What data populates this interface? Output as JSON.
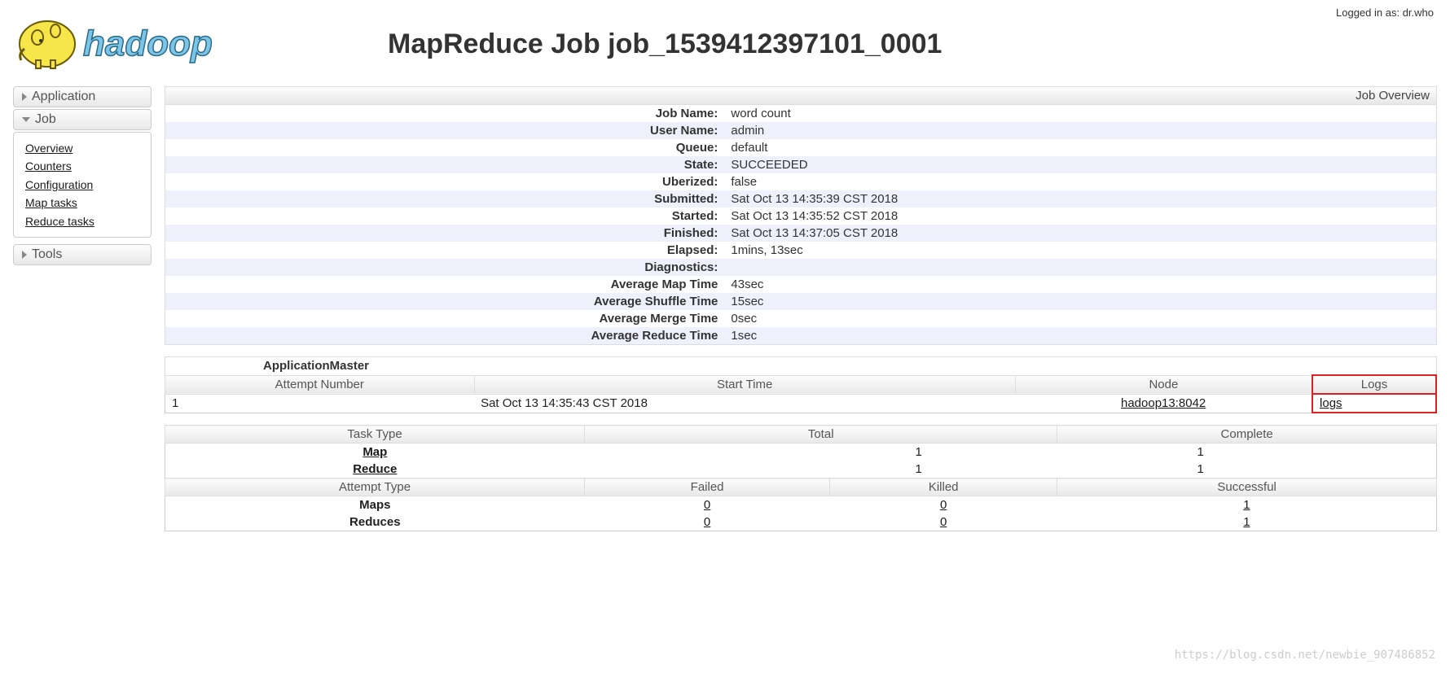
{
  "login_status": "Logged in as: dr.who",
  "page_title": "MapReduce Job job_1539412397101_0001",
  "sidebar": {
    "application": "Application",
    "job": "Job",
    "tools": "Tools",
    "job_items": [
      {
        "label": "Overview"
      },
      {
        "label": "Counters"
      },
      {
        "label": "Configuration"
      },
      {
        "label": "Map tasks"
      },
      {
        "label": "Reduce tasks"
      }
    ]
  },
  "overview": {
    "title": "Job Overview",
    "rows": [
      {
        "k": "Job Name:",
        "v": "word count"
      },
      {
        "k": "User Name:",
        "v": "admin"
      },
      {
        "k": "Queue:",
        "v": "default"
      },
      {
        "k": "State:",
        "v": "SUCCEEDED"
      },
      {
        "k": "Uberized:",
        "v": "false"
      },
      {
        "k": "Submitted:",
        "v": "Sat Oct 13 14:35:39 CST 2018"
      },
      {
        "k": "Started:",
        "v": "Sat Oct 13 14:35:52 CST 2018"
      },
      {
        "k": "Finished:",
        "v": "Sat Oct 13 14:37:05 CST 2018"
      },
      {
        "k": "Elapsed:",
        "v": "1mins, 13sec"
      },
      {
        "k": "Diagnostics:",
        "v": ""
      },
      {
        "k": "Average Map Time",
        "v": "43sec"
      },
      {
        "k": "Average Shuffle Time",
        "v": "15sec"
      },
      {
        "k": "Average Merge Time",
        "v": "0sec"
      },
      {
        "k": "Average Reduce Time",
        "v": "1sec"
      }
    ]
  },
  "app_master": {
    "title": "ApplicationMaster",
    "cols": {
      "attempt": "Attempt Number",
      "start": "Start Time",
      "node": "Node",
      "logs": "Logs"
    },
    "rows": [
      {
        "attempt": "1",
        "start": "Sat Oct 13 14:35:43 CST 2018",
        "node": "hadoop13:8042",
        "logs": "logs"
      }
    ]
  },
  "task_summary": {
    "cols": {
      "type": "Task Type",
      "total": "Total",
      "complete": "Complete"
    },
    "rows": [
      {
        "type": "Map",
        "total": "1",
        "complete": "1"
      },
      {
        "type": "Reduce",
        "total": "1",
        "complete": "1"
      }
    ]
  },
  "attempt_summary": {
    "cols": {
      "type": "Attempt Type",
      "failed": "Failed",
      "killed": "Killed",
      "success": "Successful"
    },
    "rows": [
      {
        "type": "Maps",
        "failed": "0",
        "killed": "0",
        "success": "1"
      },
      {
        "type": "Reduces",
        "failed": "0",
        "killed": "0",
        "success": "1"
      }
    ]
  },
  "watermark": "https://blog.csdn.net/newbie_907486852"
}
